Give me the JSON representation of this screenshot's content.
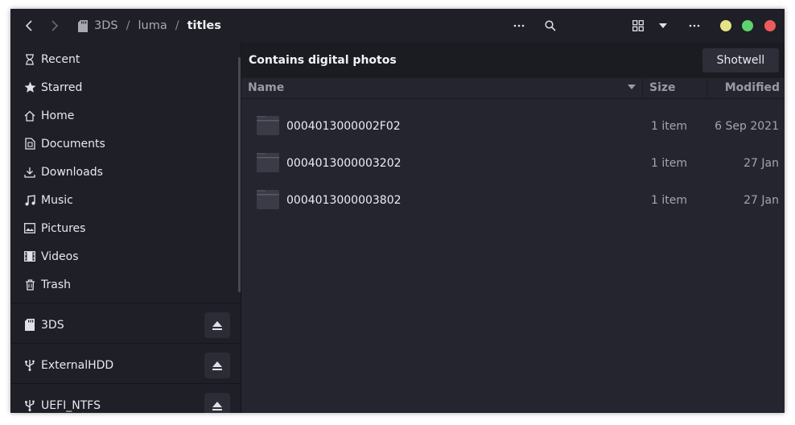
{
  "header": {
    "breadcrumbs": [
      {
        "label": "3DS"
      },
      {
        "label": "luma"
      },
      {
        "label": "titles"
      }
    ],
    "separator": "/"
  },
  "sidebar": {
    "places": [
      {
        "label": "Recent",
        "icon": "clock-icon"
      },
      {
        "label": "Starred",
        "icon": "star-icon"
      },
      {
        "label": "Home",
        "icon": "home-icon"
      },
      {
        "label": "Documents",
        "icon": "document-icon"
      },
      {
        "label": "Downloads",
        "icon": "download-icon"
      },
      {
        "label": "Music",
        "icon": "music-note-icon"
      },
      {
        "label": "Pictures",
        "icon": "picture-icon"
      },
      {
        "label": "Videos",
        "icon": "film-icon"
      },
      {
        "label": "Trash",
        "icon": "trash-icon"
      }
    ],
    "devices": [
      {
        "label": "3DS",
        "icon": "sd-card-icon"
      },
      {
        "label": "ExternalHDD",
        "icon": "usb-icon"
      },
      {
        "label": "UEFI_NTFS",
        "icon": "usb-icon"
      }
    ]
  },
  "infobar": {
    "text": "Contains digital photos",
    "button_label": "Shotwell"
  },
  "columns": {
    "name": "Name",
    "size": "Size",
    "modified": "Modified"
  },
  "files": [
    {
      "name": "0004013000002F02",
      "size": "1 item",
      "modified": "6 Sep 2021"
    },
    {
      "name": "0004013000003202",
      "size": "1 item",
      "modified": "27 Jan"
    },
    {
      "name": "0004013000003802",
      "size": "1 item",
      "modified": "27 Jan"
    }
  ],
  "colors": {
    "window_bg": "#25252f",
    "sidebar_bg": "#1f1f27",
    "window_close": "#ee5b5b",
    "window_maximize": "#5fd36f",
    "window_minimize": "#e6e288"
  }
}
